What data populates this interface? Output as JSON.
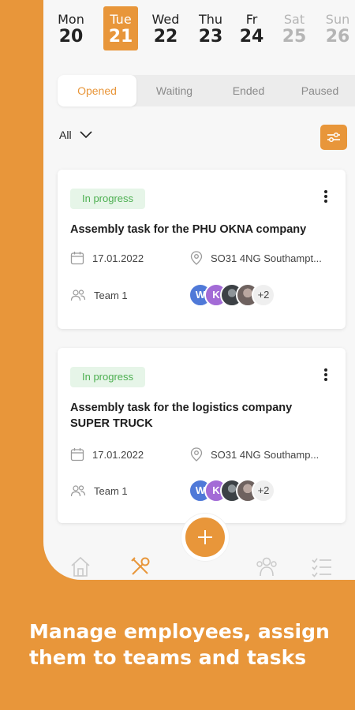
{
  "week": [
    {
      "name": "Mon",
      "num": "20",
      "state": "normal"
    },
    {
      "name": "Tue",
      "num": "21",
      "state": "active"
    },
    {
      "name": "Wed",
      "num": "22",
      "state": "normal"
    },
    {
      "name": "Thu",
      "num": "23",
      "state": "normal"
    },
    {
      "name": "Fr",
      "num": "24",
      "state": "normal"
    },
    {
      "name": "Sat",
      "num": "25",
      "state": "muted"
    },
    {
      "name": "Sun",
      "num": "26",
      "state": "muted"
    }
  ],
  "tabs": [
    "Opened",
    "Waiting",
    "Ended",
    "Paused"
  ],
  "selected_tab": "Opened",
  "filter": {
    "label": "All"
  },
  "tasks": [
    {
      "status": "In progress",
      "title": "Assembly task for the PHU OKNA company",
      "date": "17.01.2022",
      "location": "SO31 4NG Southampt...",
      "team": "Team 1",
      "avatars": [
        {
          "letter": "W",
          "color": "#4F79D8"
        },
        {
          "letter": "K",
          "color": "#A36BD6"
        },
        {
          "letter": "",
          "color": "#4A4F54"
        },
        {
          "letter": "",
          "color": "#7B6E6A"
        }
      ],
      "more": "+2"
    },
    {
      "status": "In progress",
      "title": "Assembly task for the logistics company SUPER TRUCK",
      "date": "17.01.2022",
      "location": "SO31 4NG Southamp...",
      "team": "Team 1",
      "avatars": [
        {
          "letter": "W",
          "color": "#4F79D8"
        },
        {
          "letter": "K",
          "color": "#A36BD6"
        },
        {
          "letter": "",
          "color": "#4A4F54"
        },
        {
          "letter": "",
          "color": "#7B6E6A"
        }
      ],
      "more": "+2"
    }
  ],
  "caption": "Manage employees, assign them to teams and tasks",
  "colors": {
    "accent": "#E8963A",
    "badge_bg": "#E6F5E8",
    "badge_text": "#4CAF50"
  },
  "nav_icons": [
    "home-icon",
    "tools-icon",
    "team-icon",
    "checklist-icon"
  ]
}
